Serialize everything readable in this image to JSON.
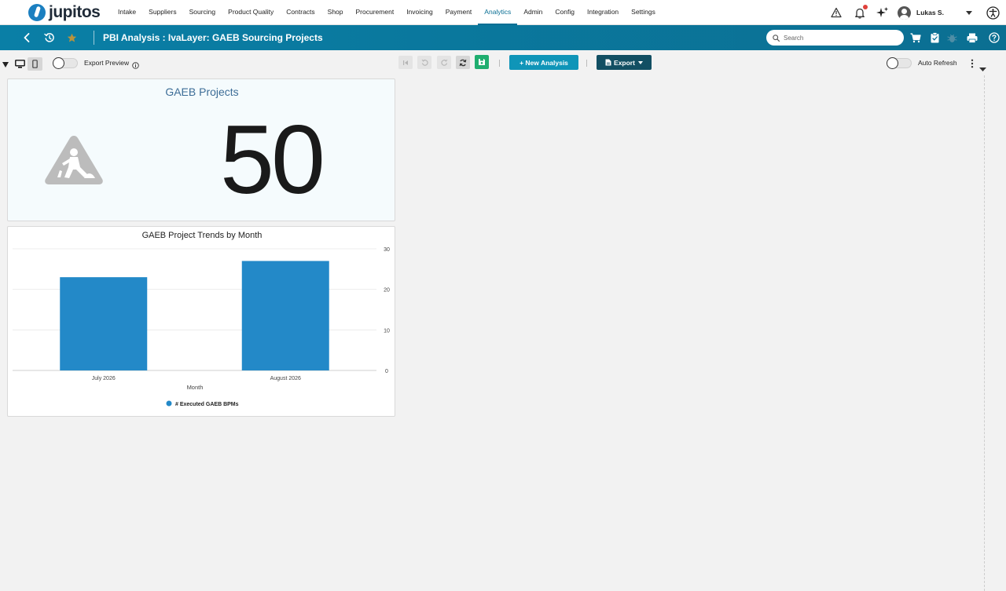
{
  "app": {
    "name": "jupitos",
    "nav": [
      "Intake",
      "Suppliers",
      "Sourcing",
      "Product Quality",
      "Contracts",
      "Shop",
      "Procurement",
      "Invoicing",
      "Payment",
      "Analytics",
      "Admin",
      "Config",
      "Integration",
      "Settings"
    ],
    "active_nav": "Analytics",
    "user": "Lukas S."
  },
  "titlebar": {
    "title": "PBI Analysis : IvaLayer: GAEB Sourcing Projects",
    "search_placeholder": "Search"
  },
  "toolbar": {
    "export_preview_label": "Export Preview",
    "new_analysis_label": "+ New Analysis",
    "export_label": "Export",
    "auto_refresh_label": "Auto Refresh"
  },
  "kpi": {
    "title": "GAEB Projects",
    "value": "50",
    "icon": "road-work-icon"
  },
  "chart_data": {
    "type": "bar",
    "title": "GAEB Project Trends by Month",
    "categories": [
      "July 2026",
      "August 2026"
    ],
    "series": [
      {
        "name": "# Executed GAEB BPMs",
        "values": [
          23,
          27
        ]
      }
    ],
    "xlabel": "Month",
    "ylabel": "",
    "ylim": [
      0,
      30
    ],
    "yticks": [
      0,
      10,
      20,
      30
    ],
    "grid": true,
    "legend": "bottom",
    "color": "#2389c8"
  },
  "colors": {
    "accent": "#0a7fa6",
    "primary_button": "#0f95b8",
    "dark_button": "#124f63",
    "save": "#1fae6f"
  }
}
